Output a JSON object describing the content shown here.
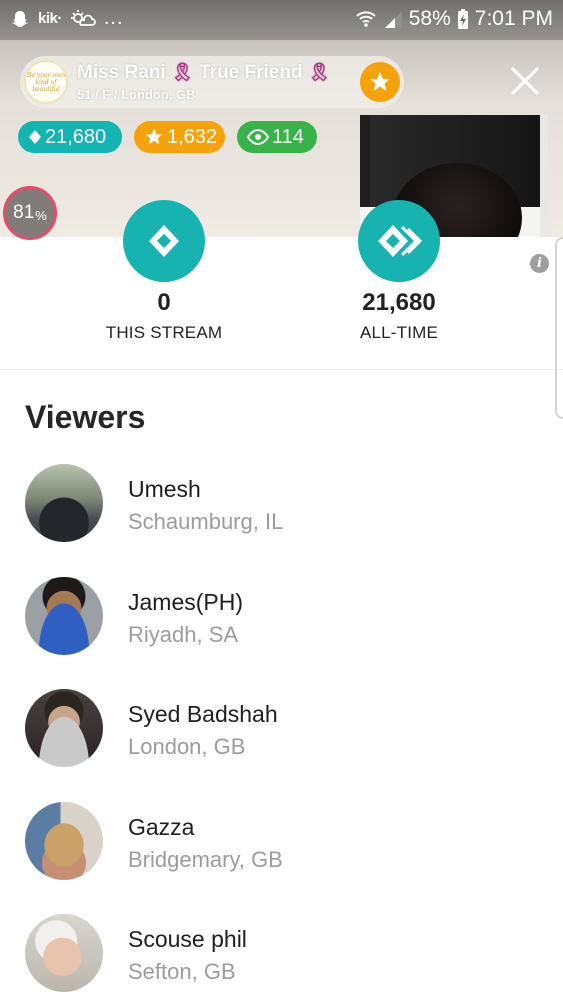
{
  "status_bar": {
    "kik_label": "kik·",
    "more_label": "...",
    "battery": "58%",
    "time": "7:01 PM"
  },
  "broadcaster": {
    "name": "Miss Rani",
    "tag": "True Friend",
    "details": "51 / F / London, GB",
    "avatar_text": "Be your own kind of beautiful"
  },
  "badges": {
    "diamonds": "21,680",
    "stars": "1,632",
    "viewers": "114"
  },
  "level_percent": "81",
  "level_percent_sign": "%",
  "stats": {
    "this_stream_value": "0",
    "this_stream_label": "THIS STREAM",
    "all_time_value": "21,680",
    "all_time_label": "ALL-TIME",
    "info_label": "i"
  },
  "viewers": {
    "title": "Viewers",
    "items": [
      {
        "name": "Umesh",
        "location": "Schaumburg, IL"
      },
      {
        "name": "James(PH)",
        "location": "Riyadh, SA"
      },
      {
        "name": "Syed Badshah",
        "location": "London, GB"
      },
      {
        "name": "Gazza",
        "location": "Bridgemary, GB"
      },
      {
        "name": "Scouse phil",
        "location": "Sefton, GB"
      }
    ]
  },
  "colors": {
    "teal": "#13b5b3",
    "orange": "#f5a20b",
    "green": "#37b34a",
    "ring": "#e84a6b"
  }
}
